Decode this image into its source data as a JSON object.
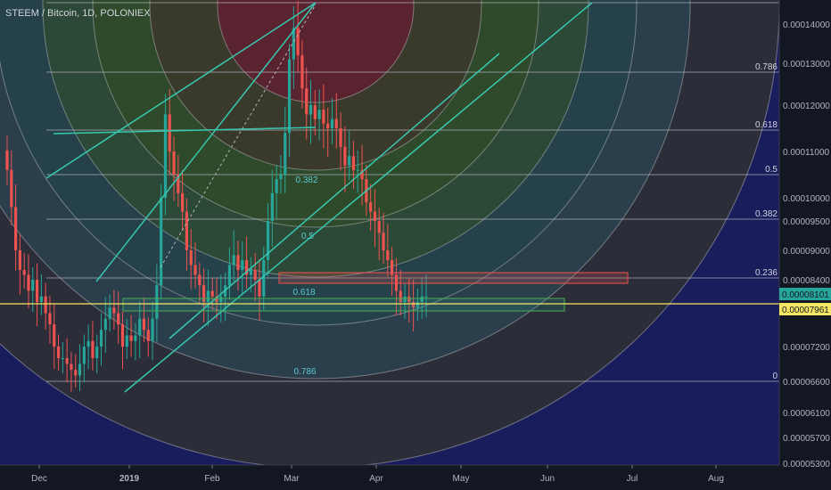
{
  "header": {
    "symbol_line": "STEEM / Bitcoin, 1D, POLONIEX"
  },
  "colors": {
    "background": "#131722",
    "navy": "#1a1d5c",
    "up": "#26a69a",
    "down": "#ef5350",
    "fan_line": "#37c8b0",
    "hline_yellow": "#f5e663"
  },
  "chart_data": {
    "type": "candlestick",
    "title": "STEEM / Bitcoin, 1D, POLONIEX",
    "x_ticks": [
      "Dec",
      "2019",
      "Feb",
      "Mar",
      "Apr",
      "May",
      "Jun",
      "Jul",
      "Aug"
    ],
    "y_ticks": [
      "0.00014000",
      "0.00013000",
      "0.00012000",
      "0.00011000",
      "0.00010000",
      "0.00009500",
      "0.00009000",
      "0.00008400",
      "0.00007200",
      "0.00006600",
      "0.00006100",
      "0.00005700",
      "0.00005300"
    ],
    "last_price": "0.00008101",
    "horizontal_line_price": "0.00007961",
    "fib_retracement_levels": [
      "1",
      "0.786",
      "0.618",
      "0.5",
      "0.382",
      "0.236",
      "0"
    ],
    "fib_fan_labels": [
      "0.382",
      "0.5",
      "0.618",
      "0.786"
    ],
    "fib_circles": [
      "0.236",
      "0.382",
      "0.5",
      "0.618",
      "0.786",
      "1",
      "1.618"
    ],
    "price_path": [
      0.000106,
      9.8e-05,
      9e-05,
      8.6e-05,
      8.5e-05,
      8.2e-05,
      8.4e-05,
      8e-05,
      8.1e-05,
      7.8e-05,
      7.6e-05,
      7.2e-05,
      7e-05,
      7e-05,
      6.9e-05,
      6.8e-05,
      6.7e-05,
      6.9e-05,
      7.2e-05,
      7.3e-05,
      7e-05,
      7.2e-05,
      7.5e-05,
      7.7e-05,
      7.9e-05,
      7.8e-05,
      7.6e-05,
      7.2e-05,
      7.4e-05,
      7.3e-05,
      7.4e-05,
      7.7e-05,
      7.5e-05,
      7.3e-05,
      7.7e-05,
      8.3e-05,
      0.0001,
      0.000118,
      0.00011,
      0.000105,
      0.000101,
      9.7e-05,
      9e-05,
      8.7e-05,
      8.5e-05,
      8.3e-05,
      8e-05,
      8.2e-05,
      8.1e-05,
      8e-05,
      8.1e-05,
      8.3e-05,
      8.7e-05,
      8.9e-05,
      8.6e-05,
      8.8e-05,
      8.5e-05,
      8.6e-05,
      8.4e-05,
      8.1e-05,
      8.8e-05,
      9.5e-05,
      0.000101,
      0.000104,
      0.000105,
      0.000114,
      0.000131,
      0.000139,
      0.000132,
      0.000124,
      0.000118,
      0.00012,
      0.000117,
      0.000119,
      0.000116,
      0.000115,
      0.000117,
      0.000115,
      0.000111,
      0.000107,
      0.000109,
      0.000106,
      0.000106,
      0.000104,
      9.9e-05,
      9.7e-05,
      9.5e-05,
      9.3e-05,
      9e-05,
      8.8e-05,
      8.5e-05,
      8.2e-05,
      8e-05,
      8.1e-05,
      8e-05,
      7.9e-05,
      8e-05,
      8.1e-05,
      8.1e-05
    ]
  }
}
